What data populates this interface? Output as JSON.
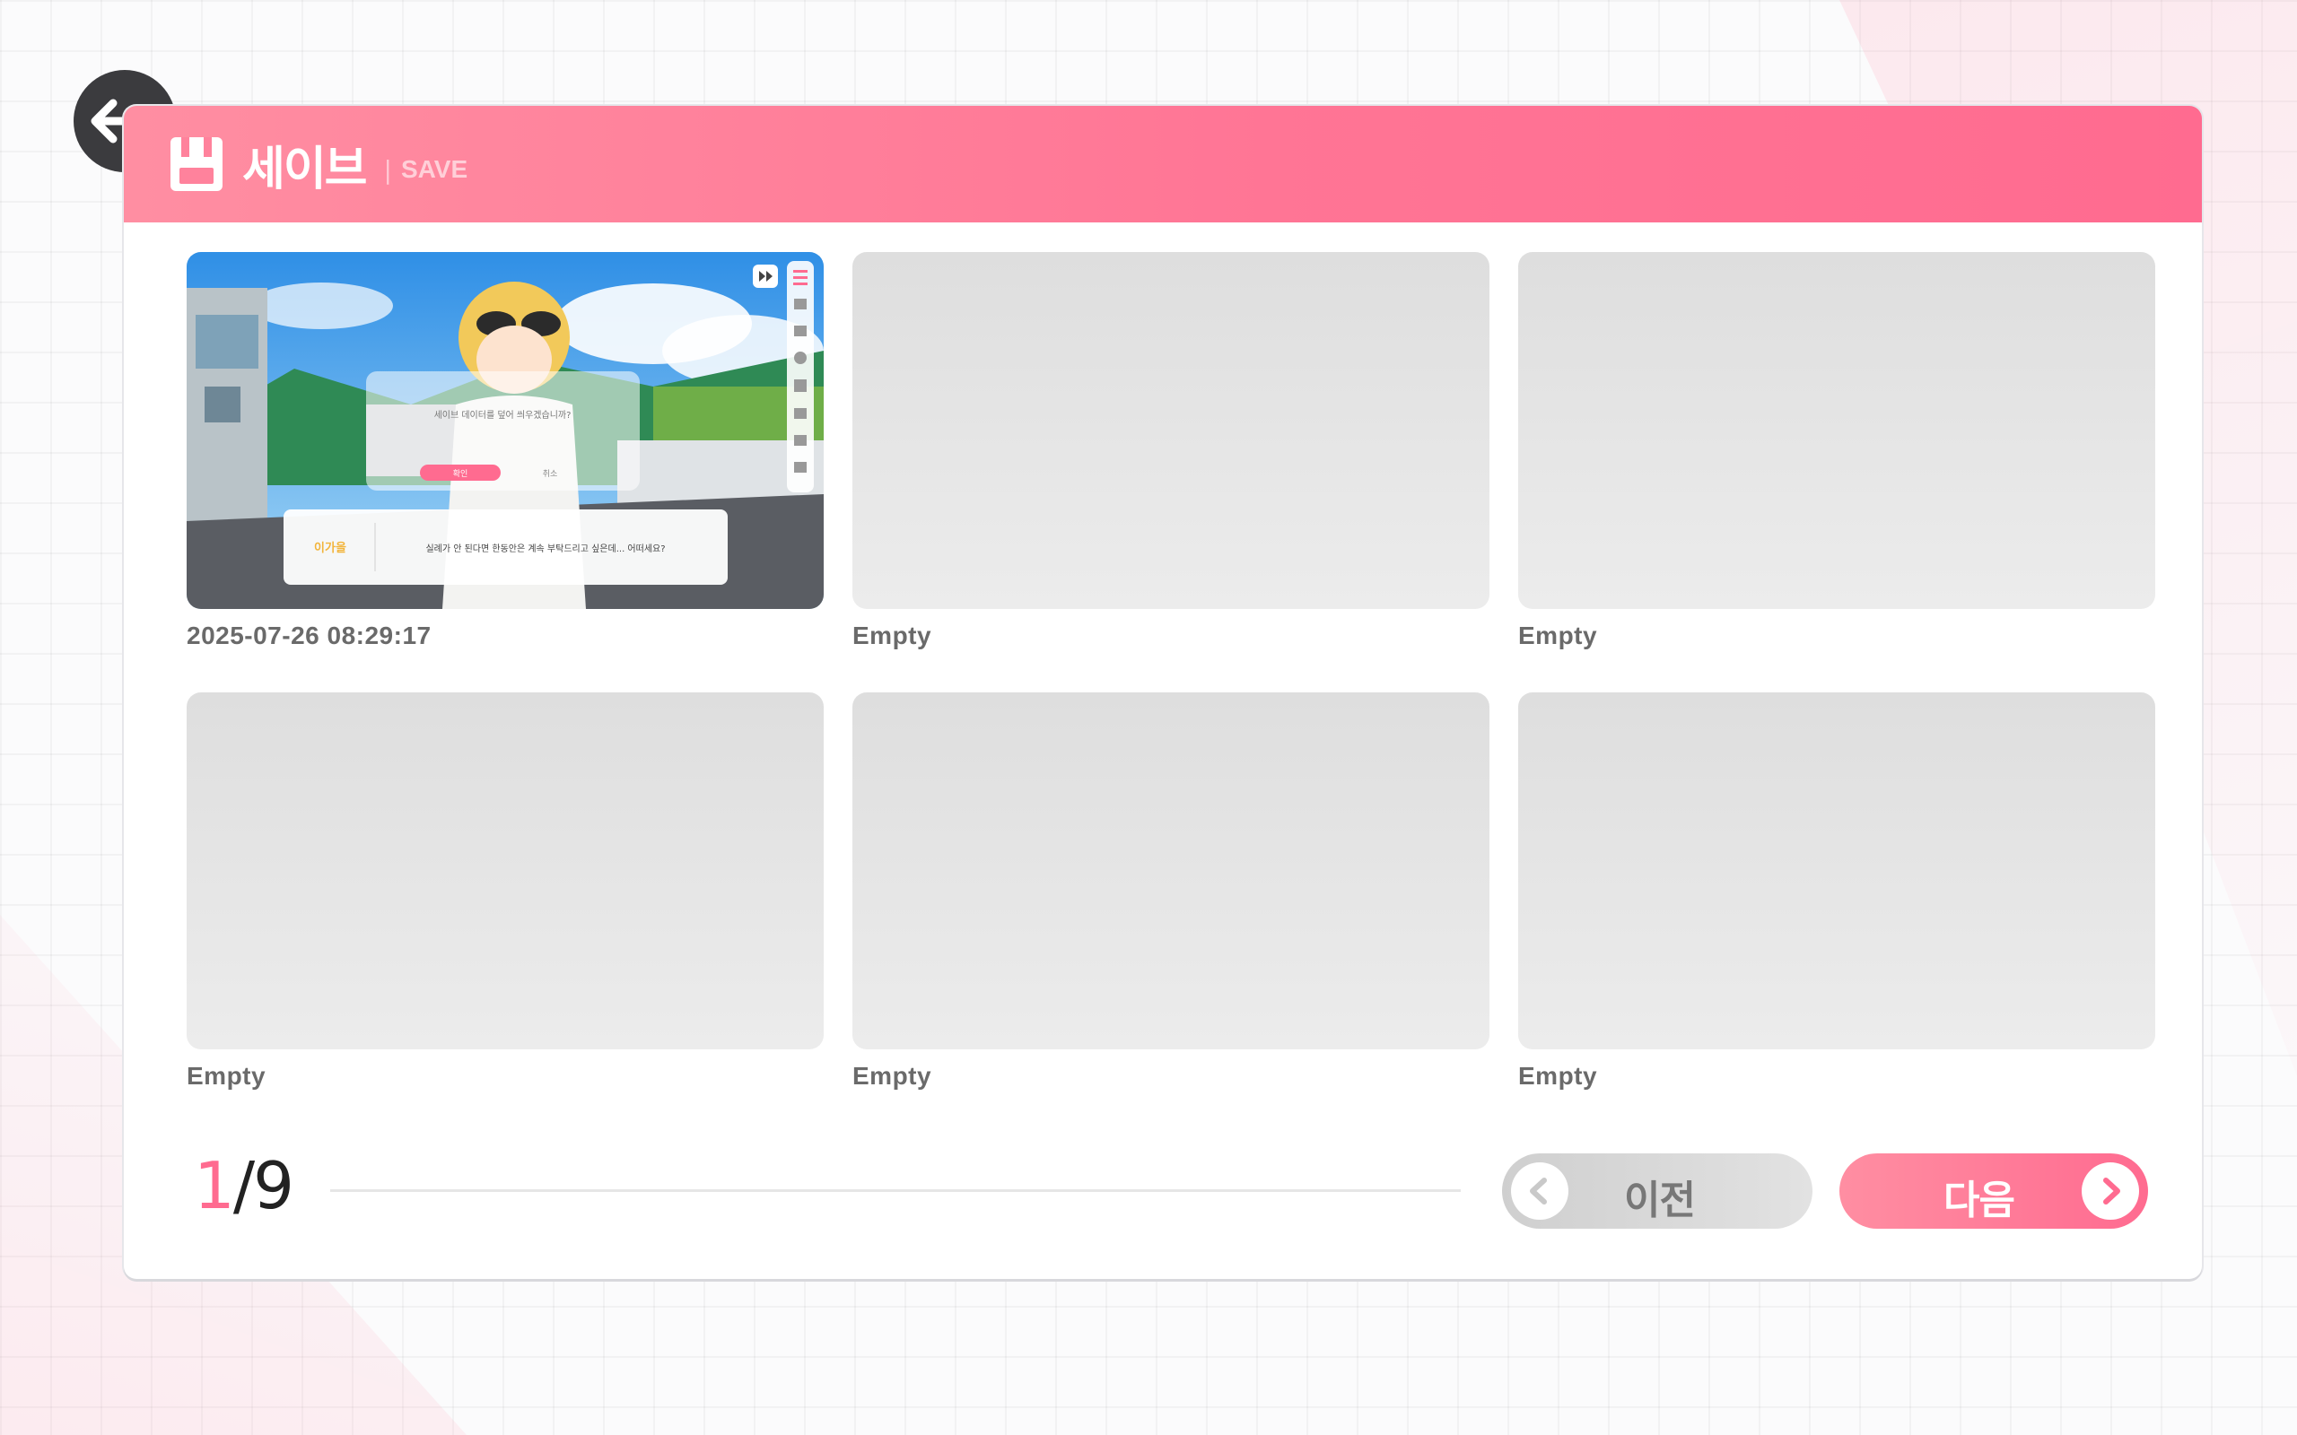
{
  "header": {
    "title": "세이브",
    "separator": "|",
    "subtitle": "SAVE"
  },
  "slots": [
    {
      "label": "2025-07-26 08:29:17",
      "filled": true
    },
    {
      "label": "Empty",
      "filled": false
    },
    {
      "label": "Empty",
      "filled": false
    },
    {
      "label": "Empty",
      "filled": false
    },
    {
      "label": "Empty",
      "filled": false
    },
    {
      "label": "Empty",
      "filled": false
    }
  ],
  "thumbnail": {
    "character_name": "이가을",
    "dialogue": "실례가 안 된다면 한동안은 계속 부탁드리고 싶은데... 어떠세요?",
    "popup_text": "세이브 데이터를 덮어 씌우겠습니까?",
    "popup_confirm": "확인",
    "popup_cancel": "취소"
  },
  "pagination": {
    "current": "1",
    "separator": "/",
    "total": "9"
  },
  "buttons": {
    "prev_label": "이전",
    "next_label": "다음"
  },
  "colors": {
    "accent": "#ff6b90",
    "header_start": "#ff8ea2",
    "empty_slot": "#e4e4e4",
    "label_text": "#6a6a6a"
  }
}
